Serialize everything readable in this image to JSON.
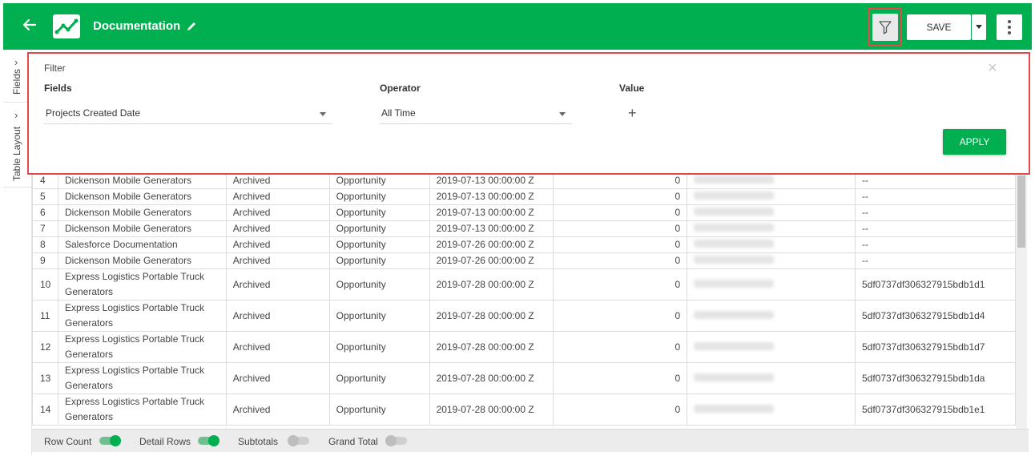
{
  "header": {
    "title": "Documentation",
    "save_label": "SAVE"
  },
  "sidebar": {
    "tabs": [
      {
        "label": "Fields"
      },
      {
        "label": "Table Layout"
      }
    ]
  },
  "filter": {
    "title": "Filter",
    "fields_label": "Fields",
    "operator_label": "Operator",
    "value_label": "Value",
    "field_value": "Projects Created Date",
    "operator_value": "All Time",
    "apply_label": "APPLY"
  },
  "table": {
    "rows": [
      {
        "n": "4",
        "name": "Dickenson Mobile Generators",
        "status": "Archived",
        "type": "Opportunity",
        "date": "2019-07-13 00:00:00 Z",
        "count": "0",
        "id": "--"
      },
      {
        "n": "5",
        "name": "Dickenson Mobile Generators",
        "status": "Archived",
        "type": "Opportunity",
        "date": "2019-07-13 00:00:00 Z",
        "count": "0",
        "id": "--"
      },
      {
        "n": "6",
        "name": "Dickenson Mobile Generators",
        "status": "Archived",
        "type": "Opportunity",
        "date": "2019-07-13 00:00:00 Z",
        "count": "0",
        "id": "--"
      },
      {
        "n": "7",
        "name": "Dickenson Mobile Generators",
        "status": "Archived",
        "type": "Opportunity",
        "date": "2019-07-13 00:00:00 Z",
        "count": "0",
        "id": "--"
      },
      {
        "n": "8",
        "name": "Salesforce Documentation",
        "status": "Archived",
        "type": "Opportunity",
        "date": "2019-07-26 00:00:00 Z",
        "count": "0",
        "id": "--"
      },
      {
        "n": "9",
        "name": "Dickenson Mobile Generators",
        "status": "Archived",
        "type": "Opportunity",
        "date": "2019-07-26 00:00:00 Z",
        "count": "0",
        "id": "--"
      },
      {
        "n": "10",
        "name": "Express Logistics Portable Truck Generators",
        "status": "Archived",
        "type": "Opportunity",
        "date": "2019-07-28 00:00:00 Z",
        "count": "0",
        "id": "5df0737df306327915bdb1d1"
      },
      {
        "n": "11",
        "name": "Express Logistics Portable Truck Generators",
        "status": "Archived",
        "type": "Opportunity",
        "date": "2019-07-28 00:00:00 Z",
        "count": "0",
        "id": "5df0737df306327915bdb1d4"
      },
      {
        "n": "12",
        "name": "Express Logistics Portable Truck Generators",
        "status": "Archived",
        "type": "Opportunity",
        "date": "2019-07-28 00:00:00 Z",
        "count": "0",
        "id": "5df0737df306327915bdb1d7"
      },
      {
        "n": "13",
        "name": "Express Logistics Portable Truck Generators",
        "status": "Archived",
        "type": "Opportunity",
        "date": "2019-07-28 00:00:00 Z",
        "count": "0",
        "id": "5df0737df306327915bdb1da"
      },
      {
        "n": "14",
        "name": "Express Logistics Portable Truck Generators",
        "status": "Archived",
        "type": "Opportunity",
        "date": "2019-07-28 00:00:00 Z",
        "count": "0",
        "id": "5df0737df306327915bdb1e1"
      }
    ]
  },
  "footer": {
    "row_count": "Row Count",
    "detail_rows": "Detail Rows",
    "subtotals": "Subtotals",
    "grand_total": "Grand Total"
  },
  "colors": {
    "brand": "#00b050",
    "highlight": "#e24a4a"
  },
  "icons": [
    "back-arrow-icon",
    "chart-logo-icon",
    "pencil-icon",
    "filter-funnel-icon",
    "chevron-down-icon",
    "kebab-menu-icon",
    "chevron-right-icon",
    "close-icon",
    "plus-icon"
  ]
}
